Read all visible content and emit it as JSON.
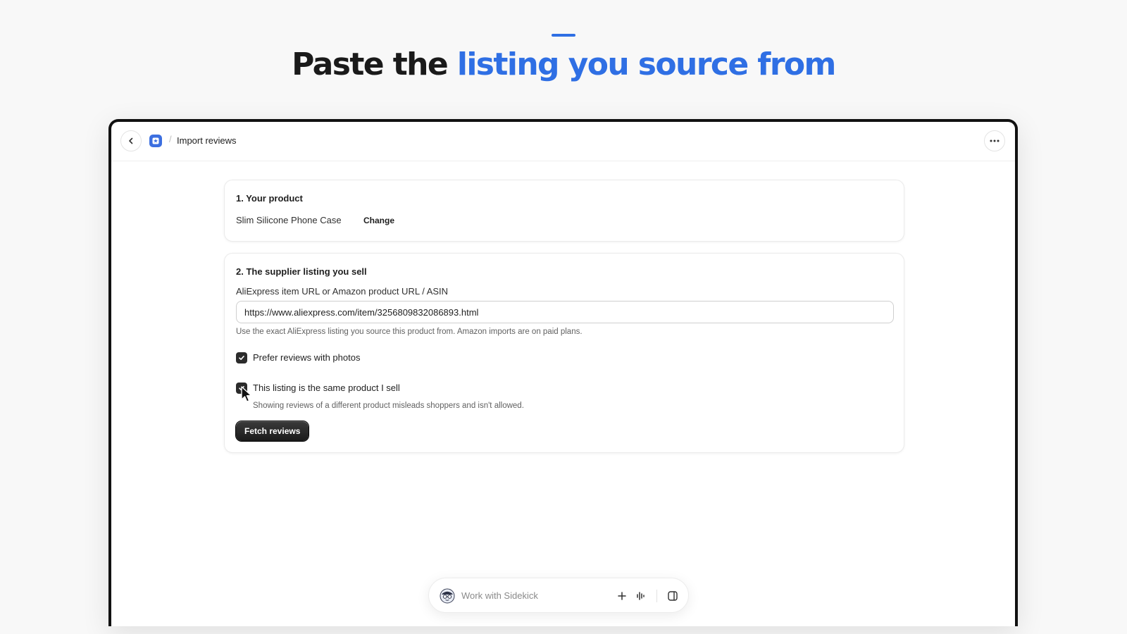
{
  "headline": {
    "prefix": "Paste the ",
    "highlight": "listing you source from",
    "accent_color": "#2f6fe4"
  },
  "topbar": {
    "breadcrumb_separator": "/",
    "title": "Import reviews",
    "back_icon": "chevron-left-icon",
    "app_icon": "star-app-icon",
    "more_icon": "ellipsis-icon"
  },
  "product_card": {
    "title": "1. Your product",
    "product_name": "Slim Silicone Phone Case",
    "change_label": "Change"
  },
  "supplier_card": {
    "title": "2. The supplier listing you sell",
    "url_label": "AliExpress item URL or Amazon product URL / ASIN",
    "url_value": "https://www.aliexpress.com/item/3256809832086893.html",
    "help_text": "Use the exact AliExpress listing you source this product from. Amazon imports are on paid plans.",
    "prefer_photos_label": "Prefer reviews with photos",
    "prefer_photos_checked": true,
    "same_product_label": "This listing is the same product I sell",
    "same_product_checked": true,
    "same_product_help": "Showing reviews of a different product misleads shoppers and isn't allowed.",
    "fetch_button_label": "Fetch reviews"
  },
  "sidekick": {
    "placeholder": "Work with Sidekick",
    "icons": [
      "sidekick-avatar-icon",
      "plus-icon",
      "voice-icon",
      "panel-icon"
    ]
  }
}
